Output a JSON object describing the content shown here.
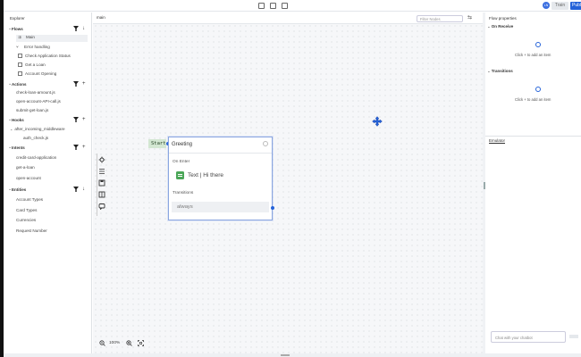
{
  "explorer": {
    "title": "Explorer",
    "sections": {
      "flows": {
        "label": "Flows",
        "items": [
          "Main",
          "Error handling",
          "Check Application Status",
          "Get a Loan",
          "Account Opening"
        ]
      },
      "actions": {
        "label": "Actions",
        "items": [
          "check-loan-amount.js",
          "open-account-API-call.js",
          "submit-get-loan.js"
        ]
      },
      "hooks": {
        "label": "Hooks",
        "items": [
          "after_incoming_middleware",
          "auth_check.js"
        ]
      },
      "intents": {
        "label": "Intents",
        "items": [
          "credit-card-application",
          "get-a-loan",
          "open-account"
        ]
      },
      "entities": {
        "label": "Entities",
        "items": [
          "Account Types",
          "Card Types",
          "Currencies",
          "Request Number"
        ]
      }
    }
  },
  "canvas": {
    "tab": "main",
    "filter_placeholder": "Filter Nodes",
    "start_label": "Start",
    "zoom_level": "100%",
    "node": {
      "title": "Greeting",
      "on_enter_label": "On Enter",
      "text_item": "Text | Hi there",
      "transitions_label": "Transitions",
      "transition": "always"
    }
  },
  "topbar": {
    "avatar": "LN",
    "train_label": "Train",
    "publish_label": "Publi"
  },
  "flow_properties": {
    "title": "Flow properties",
    "on_receive_label": "On Receive",
    "on_receive_hint": "Click + to add an item",
    "transitions_label": "Transitions",
    "transitions_hint": "Click + to add an item"
  },
  "emulator": {
    "title": "Emulator",
    "chat_placeholder": "Chat with your chatbot"
  },
  "colors": {
    "accent": "#2563d9",
    "start_node": "#d3e7d2",
    "text_icon": "#4aa657"
  }
}
